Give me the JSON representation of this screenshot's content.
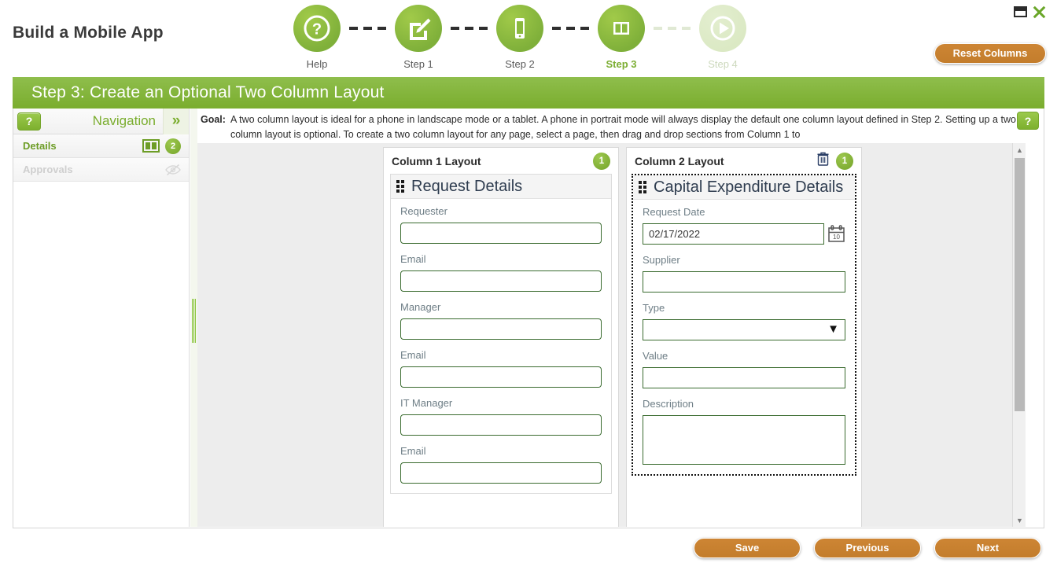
{
  "window": {
    "title": "Build a Mobile App",
    "minimize_icon": "minimize-icon",
    "close_icon": "close-icon"
  },
  "toolbar": {
    "reset_columns_label": "Reset Columns"
  },
  "stepper": {
    "steps": [
      {
        "label": "Help",
        "icon": "question-mark-circle-icon",
        "state": "done"
      },
      {
        "label": "Step 1",
        "icon": "edit-pencil-icon",
        "state": "done"
      },
      {
        "label": "Step 2",
        "icon": "mobile-phone-icon",
        "state": "done"
      },
      {
        "label": "Step 3",
        "icon": "two-column-layout-icon",
        "state": "active"
      },
      {
        "label": "Step 4",
        "icon": "play-circle-icon",
        "state": "disabled"
      }
    ]
  },
  "band": {
    "title": "Step 3: Create an Optional Two Column Layout"
  },
  "navigation": {
    "help_button_label": "?",
    "title": "Navigation",
    "expand_icon": "double-chevron-right-icon",
    "items": [
      {
        "label": "Details",
        "icon": "two-column-icon",
        "badge": "2",
        "state": "active"
      },
      {
        "label": "Approvals",
        "icon": "eye-off-icon",
        "badge": "",
        "state": "disabled"
      }
    ]
  },
  "goal": {
    "label": "Goal:",
    "text": "A two column layout is ideal for a phone in landscape mode or a tablet. A phone in portrait mode will always display the default one column layout defined in Step 2. Setting up a two column layout is optional. To create a two column layout for any page, select a page, then drag and drop sections from Column 1 to",
    "help_button_label": "?"
  },
  "columns": [
    {
      "title": "Column 1 Layout",
      "badge": "1",
      "has_trash": false,
      "section": {
        "title": "Request Details",
        "drag_handle_icon": "drag-handle-icon",
        "fields": [
          {
            "label": "Requester",
            "type": "text",
            "value": ""
          },
          {
            "label": "Email",
            "type": "text",
            "value": ""
          },
          {
            "label": "Manager",
            "type": "text",
            "value": ""
          },
          {
            "label": "Email",
            "type": "text",
            "value": ""
          },
          {
            "label": "IT Manager",
            "type": "text",
            "value": ""
          },
          {
            "label": "Email",
            "type": "text",
            "value": ""
          }
        ]
      }
    },
    {
      "title": "Column 2 Layout",
      "badge": "1",
      "has_trash": true,
      "trash_icon": "trash-icon",
      "section": {
        "title": "Capital Expenditure Details",
        "drag_handle_icon": "drag-handle-icon",
        "fields": [
          {
            "label": "Request Date",
            "type": "date",
            "value": "02/17/2022",
            "icon": "calendar-icon"
          },
          {
            "label": "Supplier",
            "type": "text",
            "value": ""
          },
          {
            "label": "Type",
            "type": "select",
            "value": "",
            "caret": "▼"
          },
          {
            "label": "Value",
            "type": "text",
            "value": ""
          },
          {
            "label": "Description",
            "type": "textarea",
            "value": ""
          }
        ]
      }
    }
  ],
  "scrollbar": {
    "up_icon": "▲",
    "down_icon": "▼"
  },
  "footer": {
    "save_label": "Save",
    "previous_label": "Previous",
    "next_label": "Next"
  },
  "colors": {
    "brand_green": "#7aad2e",
    "accent_orange": "#c37d2c",
    "field_border_green": "#3a6b2f",
    "canvas_bg": "#ededed"
  }
}
